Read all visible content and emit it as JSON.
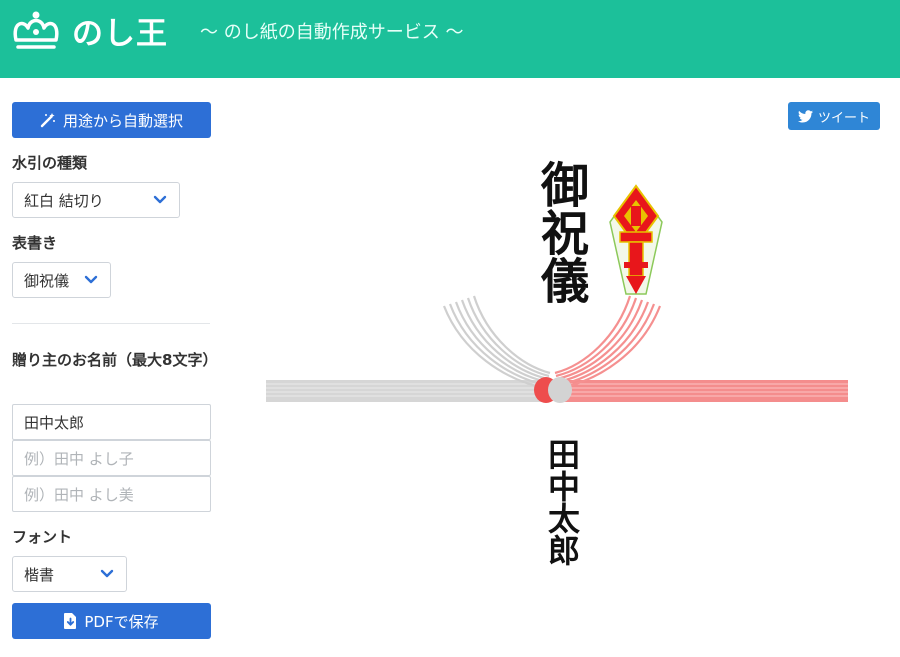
{
  "header": {
    "brand": "のし王",
    "tagline": "〜 のし紙の自動作成サービス 〜",
    "logo_icon": "crown-icon",
    "color": "#1cc09a"
  },
  "sidebar": {
    "auto_select_button": {
      "label": "用途から自動選択",
      "icon": "magic-wand-icon"
    },
    "mizuhiki": {
      "label": "水引の種類",
      "selected": "紅白 結切り"
    },
    "omotegaki": {
      "label": "表書き",
      "selected": "御祝儀"
    },
    "sender": {
      "label": "贈り主のお名前（最大8文字）",
      "inputs": [
        {
          "value": "田中太郎",
          "placeholder": ""
        },
        {
          "value": "",
          "placeholder": "例）田中 よし子"
        },
        {
          "value": "",
          "placeholder": "例）田中 よし美"
        }
      ]
    },
    "font": {
      "label": "フォント",
      "selected": "楷書"
    },
    "pdf_button": {
      "label": "PDFで保存",
      "icon": "download-file-icon"
    },
    "accent_color": "#2d6fd6"
  },
  "share": {
    "tweet_label": "ツイート",
    "icon": "twitter-bird-icon"
  },
  "noshi": {
    "omote": "御祝儀",
    "name": "田中太郎",
    "mizuhiki_colors": {
      "white": "#d5d5d5",
      "red": "#f58f8f"
    },
    "noshi_colors": {
      "red": "#e8161b",
      "gold": "#e8c200",
      "green": "#9ad25c"
    }
  }
}
